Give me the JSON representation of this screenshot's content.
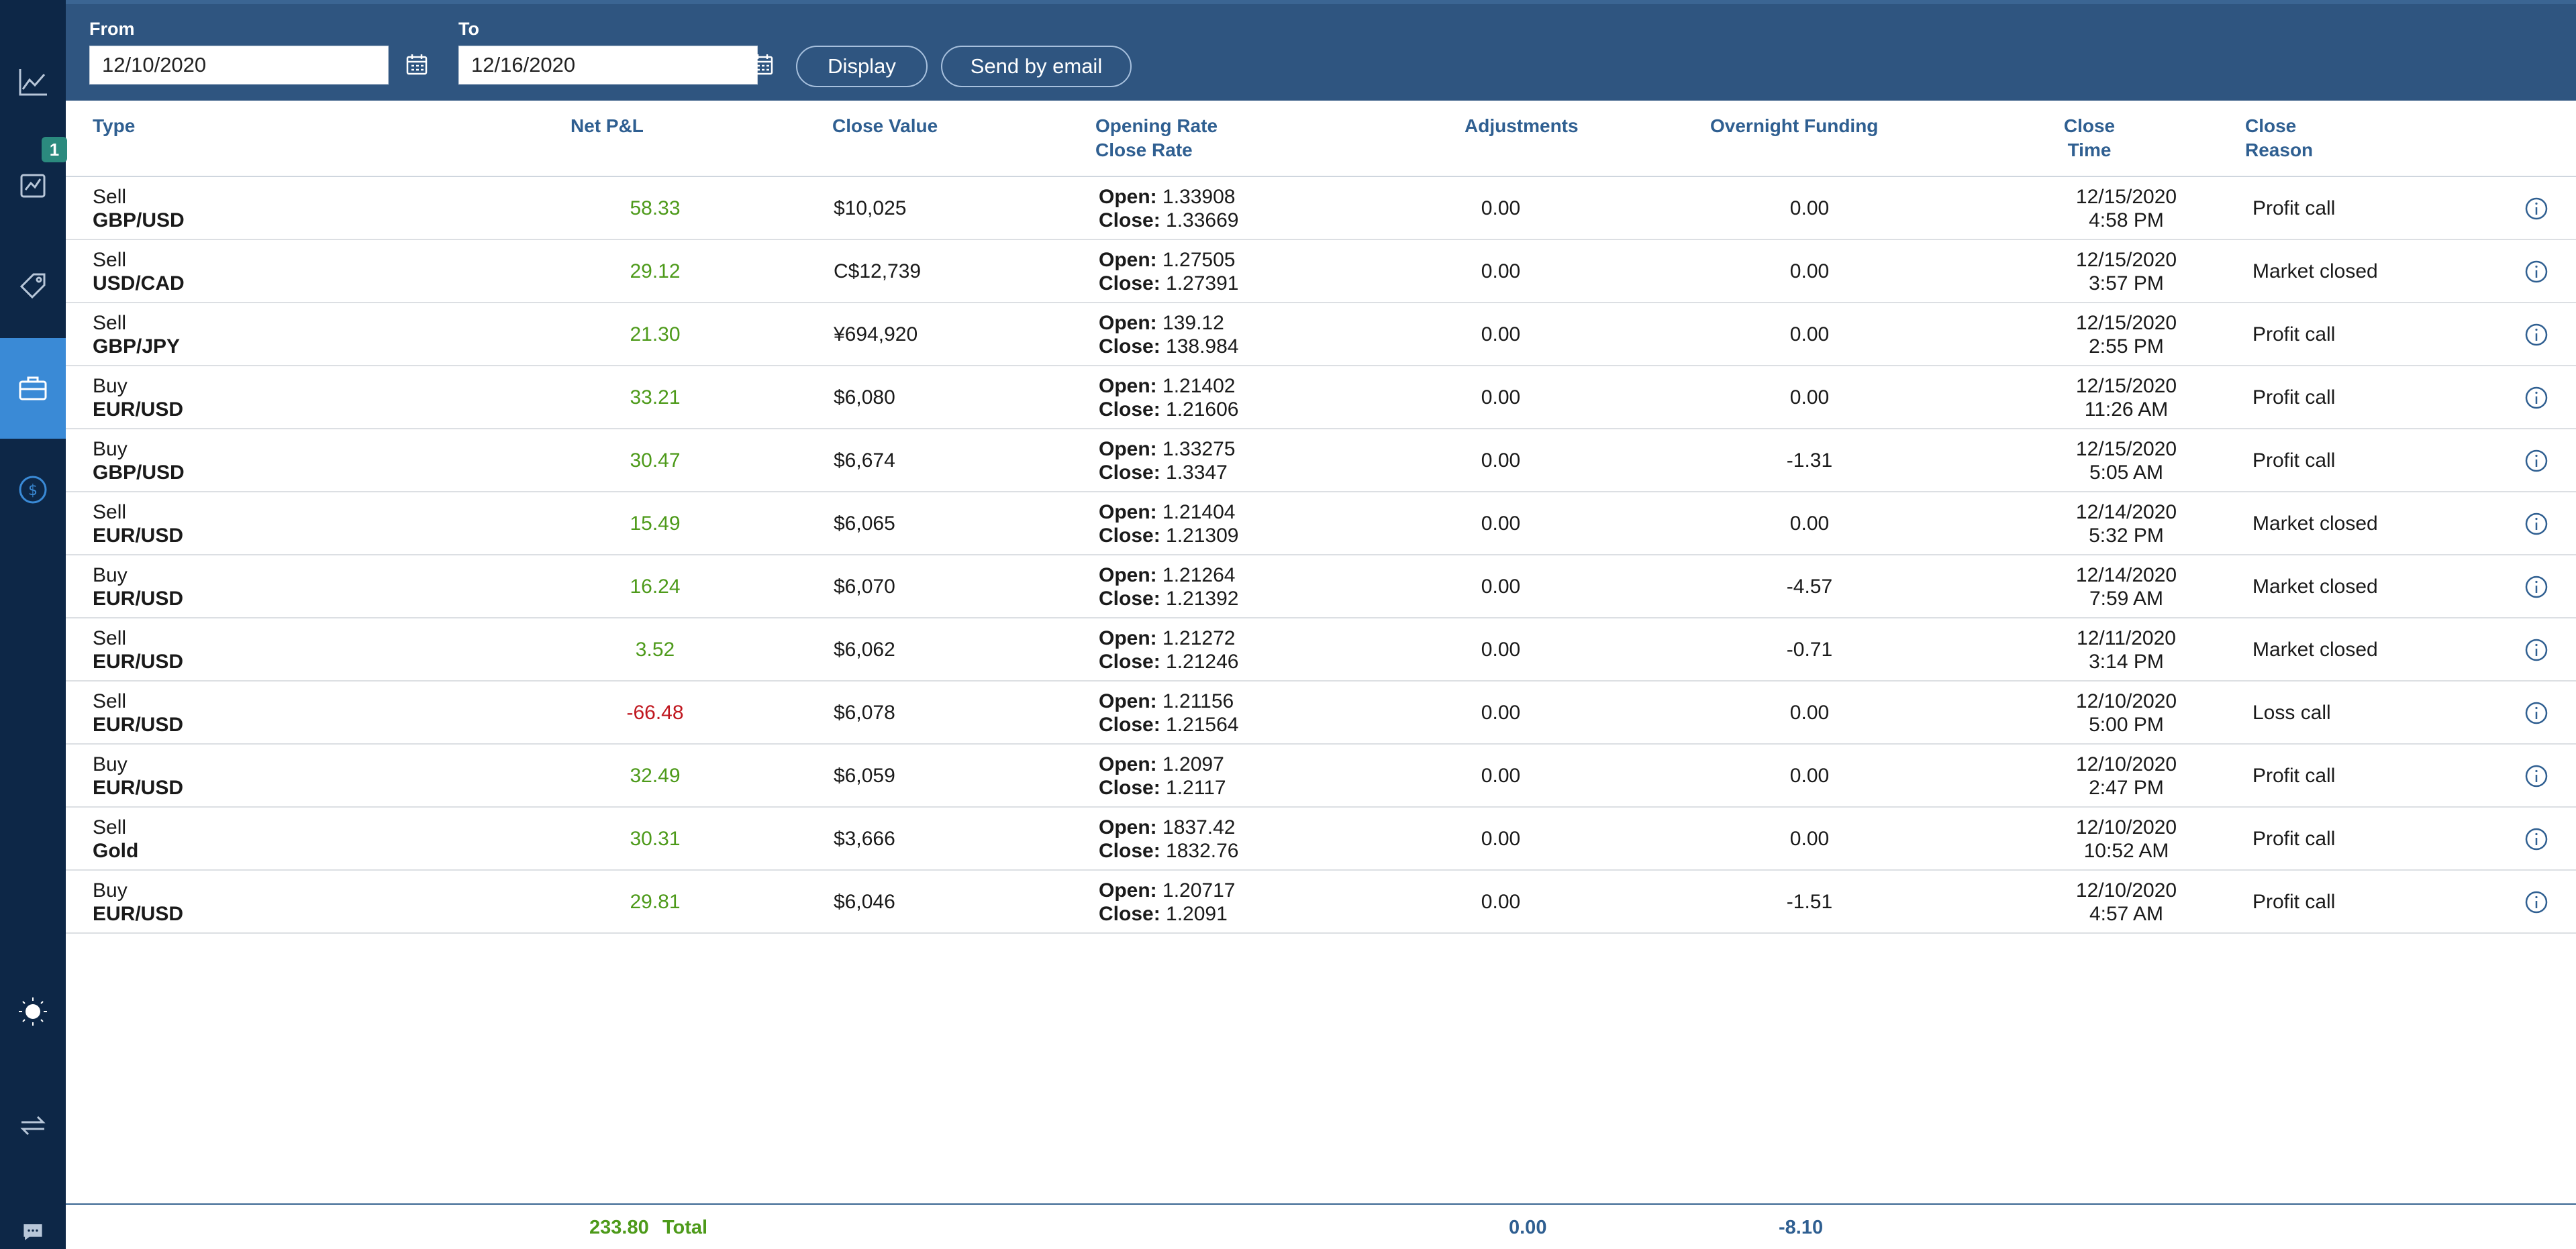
{
  "sidebar": {
    "items": [
      {
        "name": "chart-icon"
      },
      {
        "name": "trades-icon",
        "badge": "1"
      },
      {
        "name": "tag-icon"
      },
      {
        "name": "briefcase-icon"
      },
      {
        "name": "dollar-icon"
      },
      {
        "name": "theme-icon"
      },
      {
        "name": "swap-icon"
      },
      {
        "name": "chat-icon"
      }
    ]
  },
  "filters": {
    "from_label": "From",
    "from_value": "12/10/2020",
    "to_label": "To",
    "to_value": "12/16/2020",
    "display_label": "Display",
    "email_label": "Send by email"
  },
  "columns": {
    "type": "Type",
    "net_pnl": "Net P&L",
    "close_value": "Close Value",
    "opening_rate": "Opening Rate",
    "close_rate": "Close Rate",
    "adjustments": "Adjustments",
    "overnight_funding": "Overnight Funding",
    "close_time_1": "Close",
    "close_time_2": "Time",
    "close_reason_1": "Close",
    "close_reason_2": "Reason"
  },
  "labels": {
    "open": "Open:",
    "close": "Close:"
  },
  "rows": [
    {
      "side": "Sell",
      "symbol": "GBP/USD",
      "pnl": "58.33",
      "pnl_sign": "pos",
      "close_value": "$10,025",
      "open": "1.33908",
      "close": "1.33669",
      "adj": "0.00",
      "overnight": "0.00",
      "date": "12/15/2020",
      "time": "4:58 PM",
      "reason": "Profit call"
    },
    {
      "side": "Sell",
      "symbol": "USD/CAD",
      "pnl": "29.12",
      "pnl_sign": "pos",
      "close_value": "C$12,739",
      "open": "1.27505",
      "close": "1.27391",
      "adj": "0.00",
      "overnight": "0.00",
      "date": "12/15/2020",
      "time": "3:57 PM",
      "reason": "Market closed"
    },
    {
      "side": "Sell",
      "symbol": "GBP/JPY",
      "pnl": "21.30",
      "pnl_sign": "pos",
      "close_value": "¥694,920",
      "open": "139.12",
      "close": "138.984",
      "adj": "0.00",
      "overnight": "0.00",
      "date": "12/15/2020",
      "time": "2:55 PM",
      "reason": "Profit call"
    },
    {
      "side": "Buy",
      "symbol": "EUR/USD",
      "pnl": "33.21",
      "pnl_sign": "pos",
      "close_value": "$6,080",
      "open": "1.21402",
      "close": "1.21606",
      "adj": "0.00",
      "overnight": "0.00",
      "date": "12/15/2020",
      "time": "11:26 AM",
      "reason": "Profit call"
    },
    {
      "side": "Buy",
      "symbol": "GBP/USD",
      "pnl": "30.47",
      "pnl_sign": "pos",
      "close_value": "$6,674",
      "open": "1.33275",
      "close": "1.3347",
      "adj": "0.00",
      "overnight": "-1.31",
      "date": "12/15/2020",
      "time": "5:05 AM",
      "reason": "Profit call"
    },
    {
      "side": "Sell",
      "symbol": "EUR/USD",
      "pnl": "15.49",
      "pnl_sign": "pos",
      "close_value": "$6,065",
      "open": "1.21404",
      "close": "1.21309",
      "adj": "0.00",
      "overnight": "0.00",
      "date": "12/14/2020",
      "time": "5:32 PM",
      "reason": "Market closed"
    },
    {
      "side": "Buy",
      "symbol": "EUR/USD",
      "pnl": "16.24",
      "pnl_sign": "pos",
      "close_value": "$6,070",
      "open": "1.21264",
      "close": "1.21392",
      "adj": "0.00",
      "overnight": "-4.57",
      "date": "12/14/2020",
      "time": "7:59 AM",
      "reason": "Market closed"
    },
    {
      "side": "Sell",
      "symbol": "EUR/USD",
      "pnl": "3.52",
      "pnl_sign": "pos",
      "close_value": "$6,062",
      "open": "1.21272",
      "close": "1.21246",
      "adj": "0.00",
      "overnight": "-0.71",
      "date": "12/11/2020",
      "time": "3:14 PM",
      "reason": "Market closed"
    },
    {
      "side": "Sell",
      "symbol": "EUR/USD",
      "pnl": "-66.48",
      "pnl_sign": "neg",
      "close_value": "$6,078",
      "open": "1.21156",
      "close": "1.21564",
      "adj": "0.00",
      "overnight": "0.00",
      "date": "12/10/2020",
      "time": "5:00 PM",
      "reason": "Loss call"
    },
    {
      "side": "Buy",
      "symbol": "EUR/USD",
      "pnl": "32.49",
      "pnl_sign": "pos",
      "close_value": "$6,059",
      "open": "1.2097",
      "close": "1.2117",
      "adj": "0.00",
      "overnight": "0.00",
      "date": "12/10/2020",
      "time": "2:47 PM",
      "reason": "Profit call"
    },
    {
      "side": "Sell",
      "symbol": "Gold",
      "pnl": "30.31",
      "pnl_sign": "pos",
      "close_value": "$3,666",
      "open": "1837.42",
      "close": "1832.76",
      "adj": "0.00",
      "overnight": "0.00",
      "date": "12/10/2020",
      "time": "10:52 AM",
      "reason": "Profit call"
    },
    {
      "side": "Buy",
      "symbol": "EUR/USD",
      "pnl": "29.81",
      "pnl_sign": "pos",
      "close_value": "$6,046",
      "open": "1.20717",
      "close": "1.2091",
      "adj": "0.00",
      "overnight": "-1.51",
      "date": "12/10/2020",
      "time": "4:57 AM",
      "reason": "Profit call"
    }
  ],
  "totals": {
    "pnl": "233.80",
    "label": "Total",
    "adjustments": "0.00",
    "overnight": "-8.10"
  },
  "colors": {
    "sidebar": "#0d2747",
    "header": "#2f5580",
    "accent": "#2f5f91",
    "positive": "#4d9a1a",
    "negative": "#c0171f",
    "active": "#3a8ad6"
  }
}
